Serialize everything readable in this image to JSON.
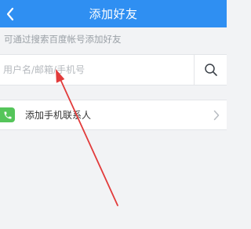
{
  "header": {
    "title": "添加好友",
    "background_color": "#2f8ff2",
    "back_icon": "chevron-left-icon"
  },
  "hint_text": "可通过搜索百度帐号添加好友",
  "search": {
    "placeholder": "用户名/邮箱/手机号",
    "value": "",
    "icon": "search-icon"
  },
  "contacts": {
    "label": "添加手机联系人",
    "icon": "phone-icon",
    "icon_color": "#55c55a",
    "chevron": "chevron-right-icon"
  },
  "annotation": {
    "icon": "red-arrow",
    "color": "#e23b3b"
  }
}
